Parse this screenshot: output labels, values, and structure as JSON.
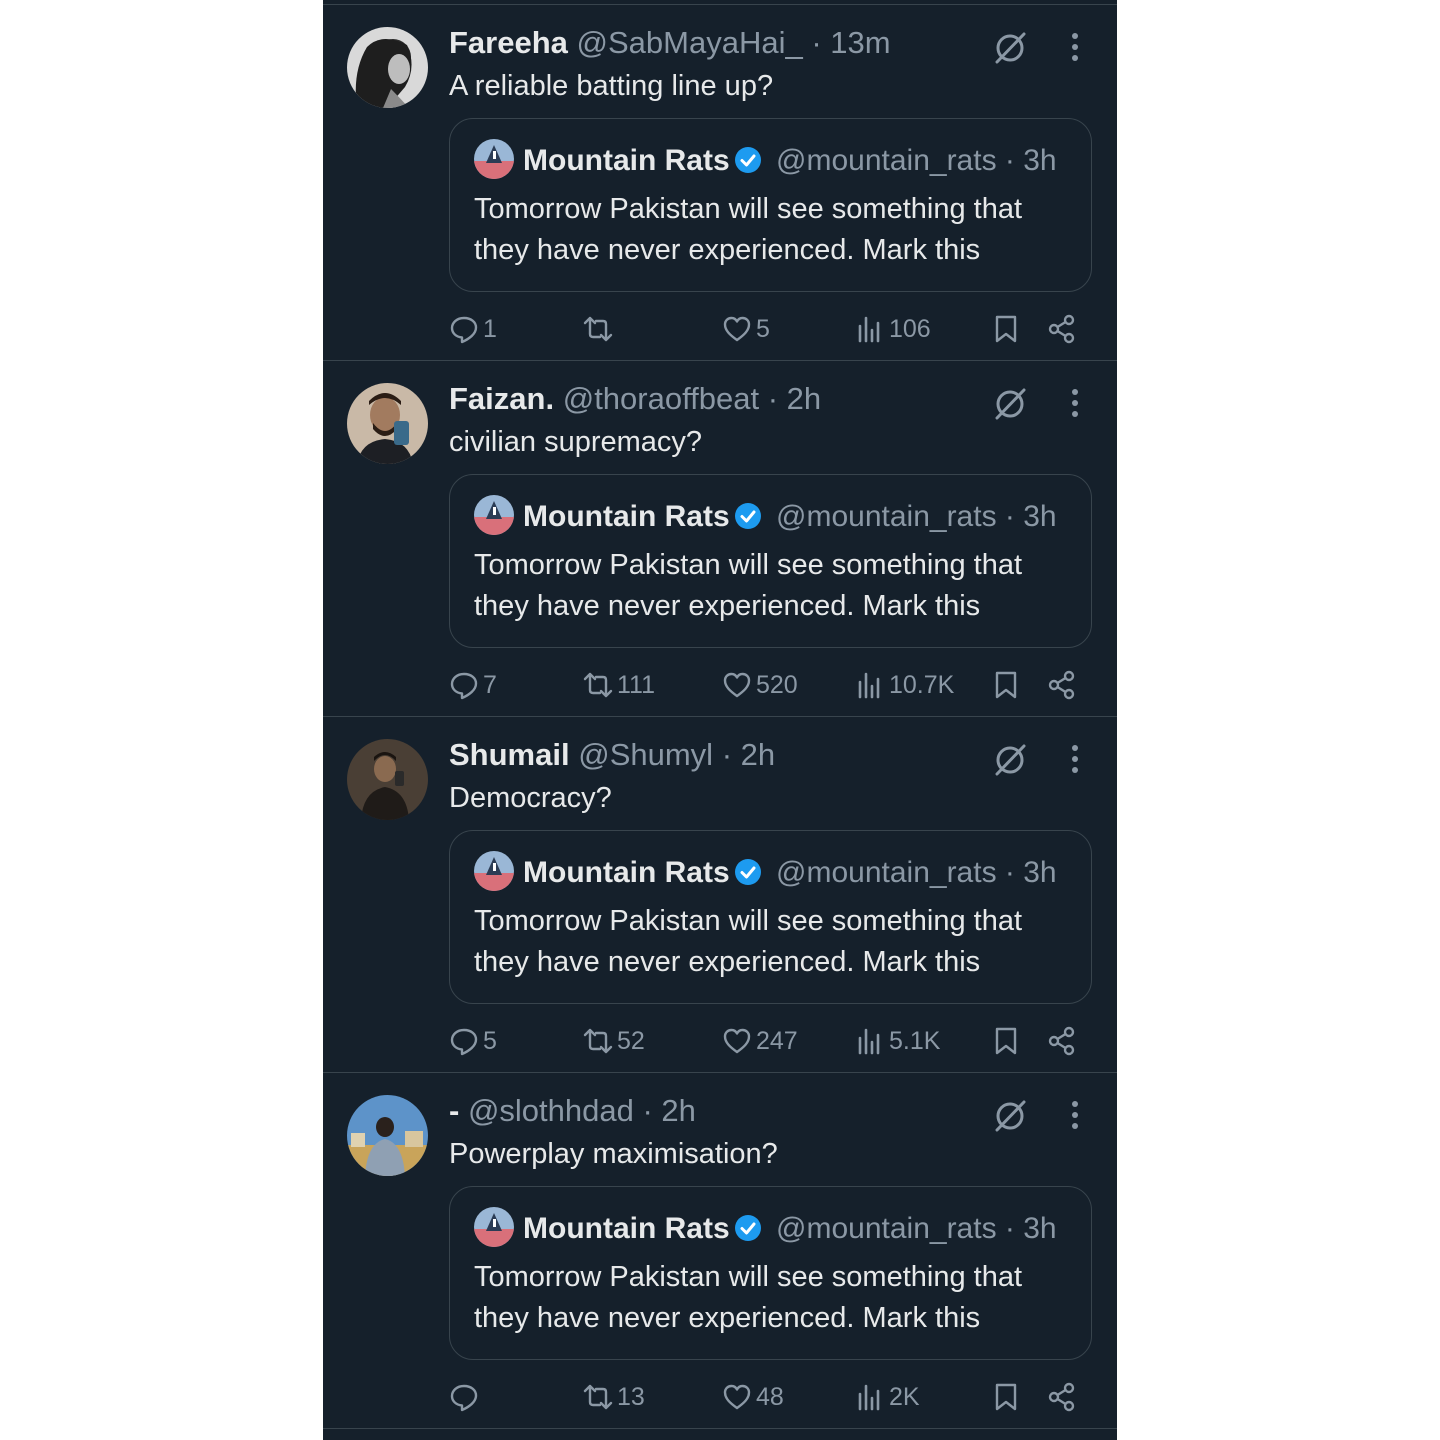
{
  "colors": {
    "background": "#15202b",
    "text": "#e7e9ea",
    "muted": "#8b98a5",
    "border": "#38444d",
    "verified": "#1d9bf0"
  },
  "icons": [
    "grok-icon",
    "more-icon",
    "verified-badge-icon",
    "reply-icon",
    "retweet-icon",
    "like-icon",
    "views-icon",
    "bookmark-icon",
    "share-icon"
  ],
  "tweets": [
    {
      "name": "Fareeha",
      "handle": "@SabMayaHai_",
      "time": "· 13m",
      "text": "A reliable batting line up?",
      "quote": {
        "name": "Mountain Rats",
        "handle": "@mountain_rats",
        "time": "· 3h",
        "text": "Tomorrow Pakistan will see something that they have never experienced. Mark this"
      },
      "replies": "1",
      "retweets": "",
      "likes": "5",
      "views": "106"
    },
    {
      "name": "Faizan.",
      "handle": "@thoraoffbeat",
      "time": "· 2h",
      "text": "civilian supremacy?",
      "quote": {
        "name": "Mountain Rats",
        "handle": "@mountain_rats",
        "time": "· 3h",
        "text": "Tomorrow Pakistan will see something that they have never experienced. Mark this"
      },
      "replies": "7",
      "retweets": "111",
      "likes": "520",
      "views": "10.7K"
    },
    {
      "name": "Shumail",
      "handle": "@Shumyl",
      "time": "· 2h",
      "text": "Democracy?",
      "quote": {
        "name": "Mountain Rats",
        "handle": "@mountain_rats",
        "time": "· 3h",
        "text": "Tomorrow Pakistan will see something that they have never experienced. Mark this"
      },
      "replies": "5",
      "retweets": "52",
      "likes": "247",
      "views": "5.1K"
    },
    {
      "name": "-",
      "handle": "@slothhdad",
      "time": "· 2h",
      "text": "Powerplay maximisation?",
      "quote": {
        "name": "Mountain Rats",
        "handle": "@mountain_rats",
        "time": "· 3h",
        "text": "Tomorrow Pakistan will see something that they have never experienced. Mark this"
      },
      "replies": "",
      "retweets": "13",
      "likes": "48",
      "views": "2K"
    }
  ]
}
